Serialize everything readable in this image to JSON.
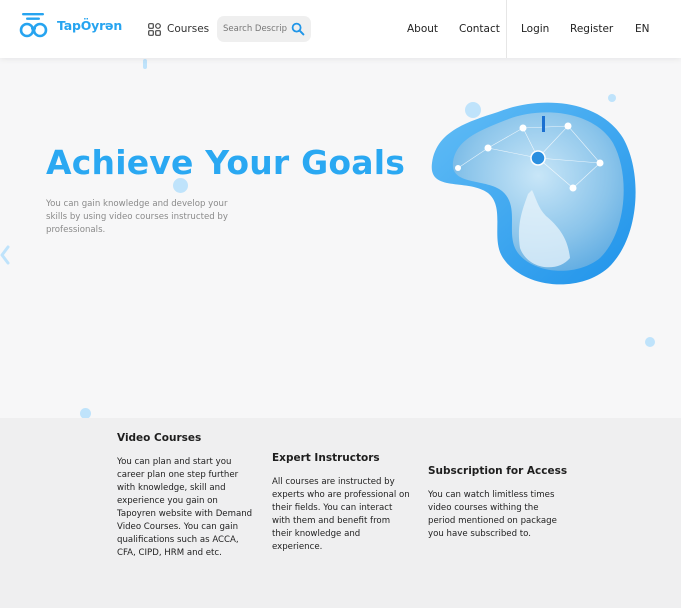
{
  "header": {
    "brand": "TapÖyrən",
    "courses_label": "Courses",
    "search_placeholder": "Search Description",
    "nav": [
      "About",
      "Contact",
      "Login",
      "Register",
      "EN"
    ]
  },
  "hero": {
    "title": "Achieve Your Goals",
    "subtitle": "You can gain knowledge and develop your skills by using video courses instructed by professionals."
  },
  "features": [
    {
      "title": "Video Courses",
      "text": "You can plan and start you career plan one step further with knowledge, skill and experience you gain on Tapoyren website with Demand Video Courses. You can gain qualifications such as ACCA, CFA, CIPD, HRM and etc."
    },
    {
      "title": "Expert Instructors",
      "text": "All courses are instructed by experts who are professional on their fields. You can interact with them and benefit from their knowledge and experience."
    },
    {
      "title": "Subscription for Access",
      "text": "You can watch limitless times video courses withing the period mentioned on package you have subscribed to."
    }
  ],
  "colors": {
    "accent": "#2aa8f2",
    "background": "#f7f7f8",
    "features_background": "#efeff0"
  },
  "icons": {
    "logo": "binoculars-logo-icon",
    "courses": "grid-icon",
    "search": "search-icon",
    "edge": "chevron-left-icon"
  }
}
